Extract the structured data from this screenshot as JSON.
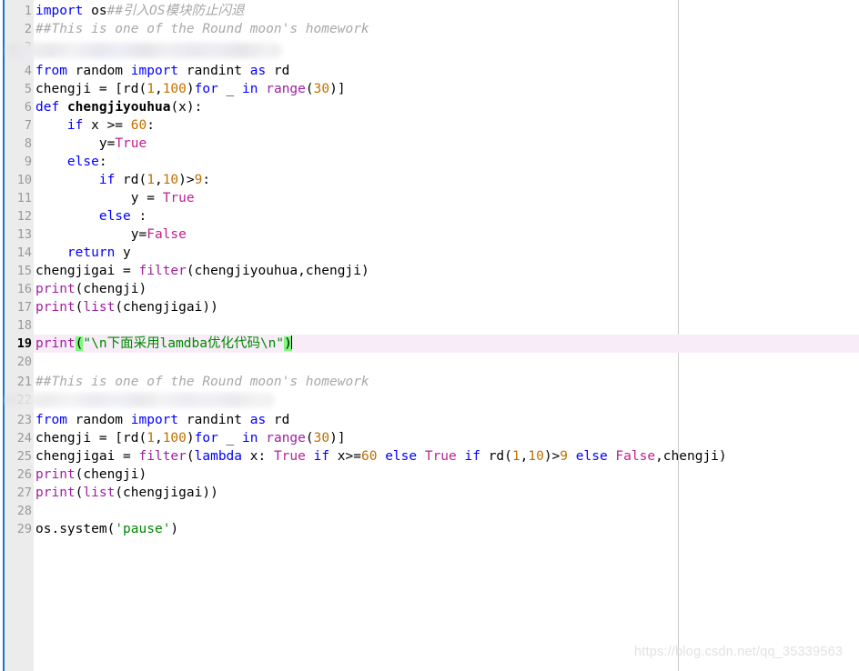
{
  "editor": {
    "language": "Python",
    "gutter_color": "#ececec",
    "accent_color": "#1177d1",
    "current_line_highlight": "#f7ecf7",
    "bracket_match_color": "#7cf87c",
    "ruler_color": "#c8c8c8",
    "current_line_number": 19,
    "total_lines": 29
  },
  "watermark": {
    "text": "https://blog.csdn.net/qq_35339563"
  },
  "lines": [
    {
      "n": "1",
      "text": "import os##引入OS模块防止闪退"
    },
    {
      "n": "2",
      "text": "##This is one of the Round moon's homework"
    },
    {
      "n": "3",
      "text": "",
      "redacted": true
    },
    {
      "n": "4",
      "text": "from random import randint as rd"
    },
    {
      "n": "5",
      "text": "chengji = [rd(1,100)for _ in range(30)]"
    },
    {
      "n": "6",
      "text": "def chengjiyouhua(x):"
    },
    {
      "n": "7",
      "text": "    if x >= 60:"
    },
    {
      "n": "8",
      "text": "        y=True"
    },
    {
      "n": "9",
      "text": "    else:"
    },
    {
      "n": "10",
      "text": "        if rd(1,10)>9:"
    },
    {
      "n": "11",
      "text": "            y = True"
    },
    {
      "n": "12",
      "text": "        else :"
    },
    {
      "n": "13",
      "text": "            y=False"
    },
    {
      "n": "14",
      "text": "    return y"
    },
    {
      "n": "15",
      "text": "chengjigai = filter(chengjiyouhua,chengji)"
    },
    {
      "n": "16",
      "text": "print(chengji)"
    },
    {
      "n": "17",
      "text": "print(list(chengjigai))"
    },
    {
      "n": "18",
      "text": ""
    },
    {
      "n": "19",
      "text": "print(\"\\n下面采用lamdba优化代码\\n\")",
      "current": true
    },
    {
      "n": "20",
      "text": ""
    },
    {
      "n": "21",
      "text": "##This is one of the Round moon's homework"
    },
    {
      "n": "22",
      "text": "",
      "redacted": true
    },
    {
      "n": "23",
      "text": "from random import randint as rd"
    },
    {
      "n": "24",
      "text": "chengji = [rd(1,100)for _ in range(30)]"
    },
    {
      "n": "25",
      "text": "chengjigai = filter(lambda x: True if x>=60 else True if rd(1,10)>9 else False,chengji)"
    },
    {
      "n": "26",
      "text": "print(chengji)"
    },
    {
      "n": "27",
      "text": "print(list(chengjigai))"
    },
    {
      "n": "28",
      "text": ""
    },
    {
      "n": "29",
      "text": "os.system('pause')"
    }
  ]
}
